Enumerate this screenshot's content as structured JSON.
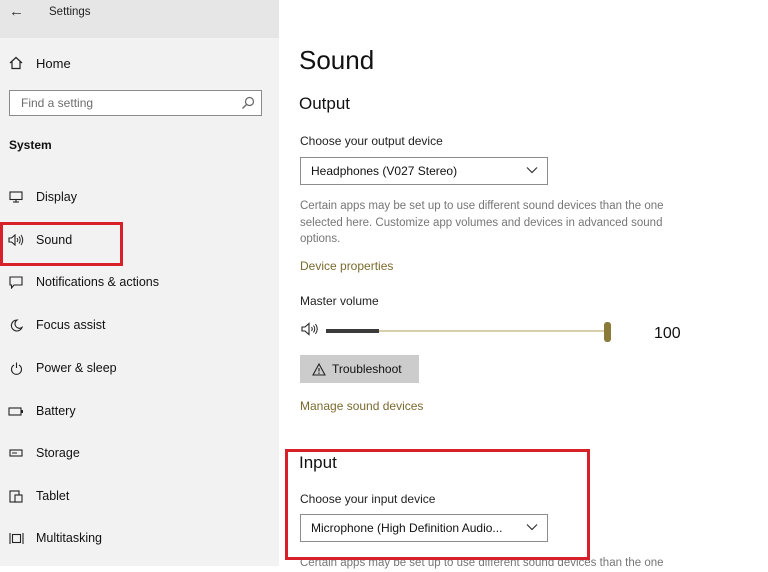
{
  "window": {
    "title": "Settings"
  },
  "sidebar": {
    "home_label": "Home",
    "search_placeholder": "Find a setting",
    "section_title": "System",
    "items": [
      {
        "label": "Display",
        "icon": "display-icon"
      },
      {
        "label": "Sound",
        "icon": "speaker-icon",
        "highlighted": true
      },
      {
        "label": "Notifications & actions",
        "icon": "notification-icon"
      },
      {
        "label": "Focus assist",
        "icon": "moon-icon"
      },
      {
        "label": "Power & sleep",
        "icon": "power-icon"
      },
      {
        "label": "Battery",
        "icon": "battery-icon"
      },
      {
        "label": "Storage",
        "icon": "storage-icon"
      },
      {
        "label": "Tablet",
        "icon": "tablet-icon"
      },
      {
        "label": "Multitasking",
        "icon": "multitasking-icon"
      }
    ]
  },
  "main": {
    "page_title": "Sound",
    "output": {
      "heading": "Output",
      "device_label": "Choose your output device",
      "device_value": "Headphones (V027 Stereo)",
      "description": "Certain apps may be set up to use different sound devices than the one selected here. Customize app volumes and devices in advanced sound options.",
      "device_properties_link": "Device properties",
      "master_volume_label": "Master volume",
      "volume": 100,
      "volume_display": "100",
      "troubleshoot_label": "Troubleshoot",
      "manage_devices_link": "Manage sound devices"
    },
    "input": {
      "heading": "Input",
      "device_label": "Choose your input device",
      "device_value": "Microphone (High Definition Audio...",
      "description_partial": "Certain apps may be set up to use different sound devices than the one"
    }
  },
  "colors": {
    "sidebar_bg": "#f2f2f2",
    "accent": "#8a7a3a",
    "link": "#7a6a2e",
    "highlight_box": "#d7202a",
    "button_bg": "#cccccc"
  }
}
